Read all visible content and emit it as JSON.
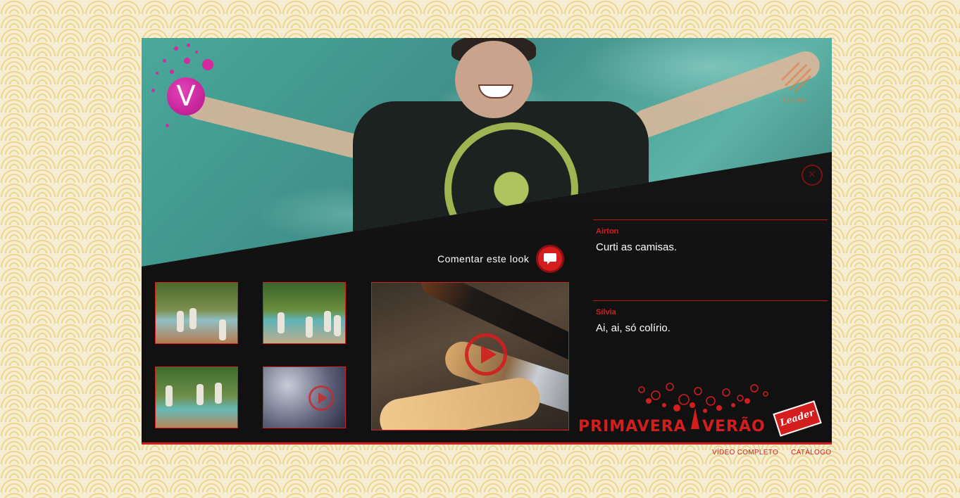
{
  "comment_action": {
    "label": "Comentar este look"
  },
  "comments": [
    {
      "author": "Airton",
      "text": "Curti as camisas."
    },
    {
      "author": "Silvia",
      "text": "Ai, ai, só colírio."
    }
  ],
  "brand": {
    "word1": "PRIMAVERA",
    "word2": "VERÃO",
    "logo_text": "Leader"
  },
  "footer": {
    "video_completo": "VÍDEO COMPLETO",
    "catalogo": "CATÁLOGO"
  },
  "top_right_label": "Cartões",
  "colors": {
    "accent": "#d41e1e",
    "logo_magenta": "#c21b93"
  },
  "icons": [
    "v-logo-icon",
    "close-icon",
    "comment-bubble-icon",
    "play-icon"
  ]
}
